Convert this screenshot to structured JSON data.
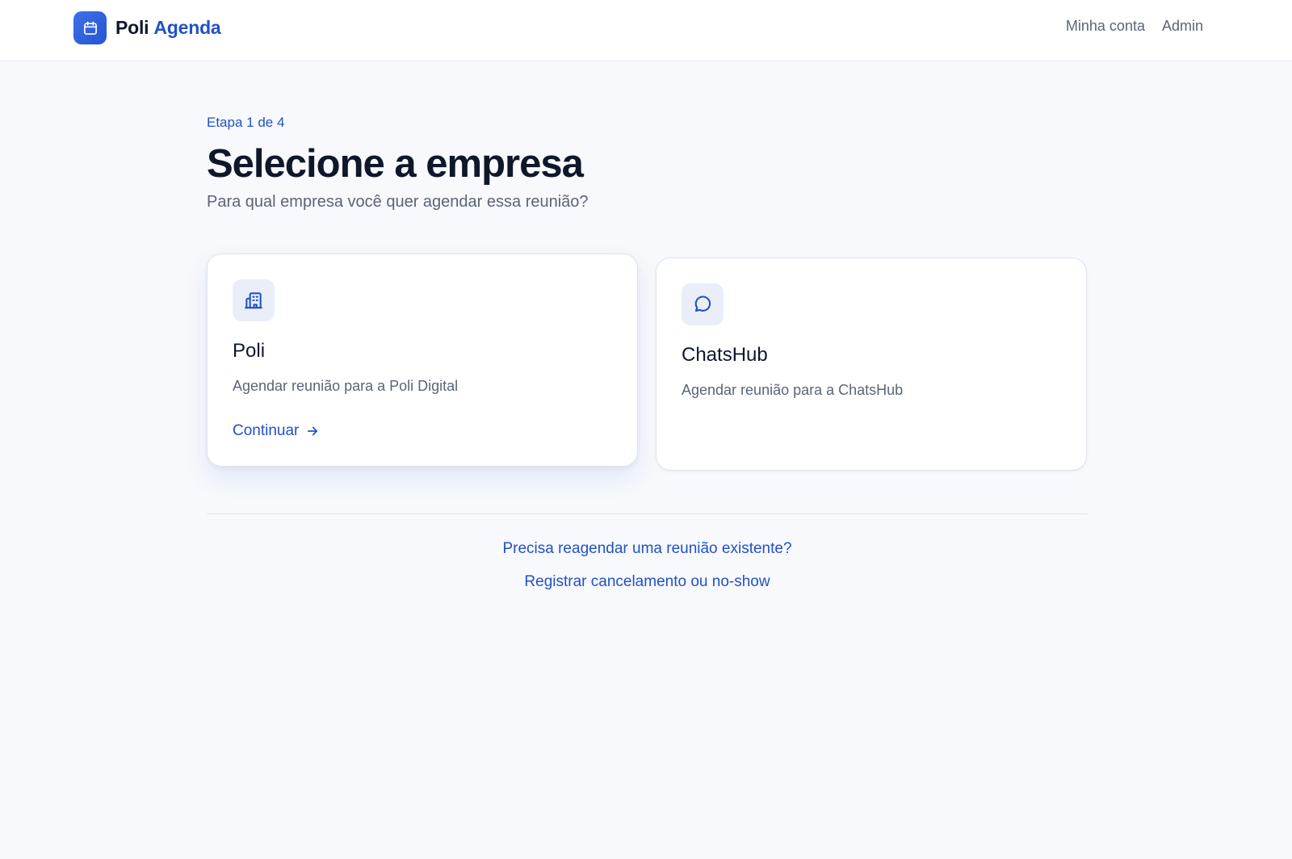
{
  "header": {
    "brand_first": "Poli",
    "brand_second": "Agenda",
    "logo_icon": "calendar-icon",
    "nav": [
      "Minha conta",
      "Admin"
    ]
  },
  "main": {
    "step": "Etapa 1 de 4",
    "title": "Selecione a empresa",
    "subtitle": "Para qual empresa você quer agendar essa reunião?"
  },
  "companies": [
    {
      "name": "Poli",
      "description": "Agendar reunião para a Poli Digital",
      "icon": "building-icon",
      "action": "Continuar",
      "action_icon": "arrow-right-icon",
      "hovered": true
    },
    {
      "name": "ChatsHub",
      "description": "Agendar reunião para a ChatsHub",
      "icon": "chat-bubble-icon",
      "hovered": false
    }
  ],
  "footer_links": {
    "reschedule": "Precisa reagendar uma reunião existente?",
    "cancel": "Registrar cancelamento ou no-show"
  },
  "colors": {
    "accent": "#2251c4",
    "background": "#f7f9fc",
    "text": "#0f172a",
    "muted": "#5b6576"
  }
}
